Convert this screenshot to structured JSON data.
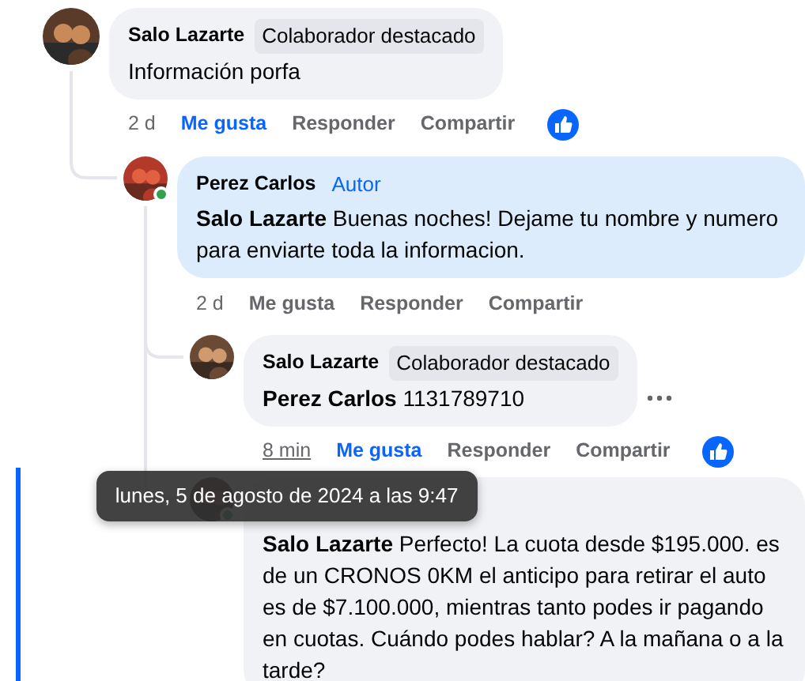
{
  "comments": [
    {
      "author": "Salo Lazarte",
      "badge": {
        "kind": "contributor",
        "label": "Colaborador destacado"
      },
      "text": "Información porfa",
      "tinted": false,
      "online": false,
      "time": "2 d",
      "time_hovered": false,
      "actions": [
        "Me gusta",
        "Responder",
        "Compartir"
      ],
      "liked": true,
      "reaction_shown": true,
      "children": [
        {
          "author": "Perez Carlos",
          "badge": {
            "kind": "author",
            "label": "Autor"
          },
          "text": "**Salo Lazarte** Buenas noches! Dejame tu nombre y numero para enviarte toda la informacion.",
          "tinted": true,
          "online": true,
          "time": "2 d",
          "time_hovered": false,
          "actions": [
            "Me gusta",
            "Responder",
            "Compartir"
          ],
          "liked": false,
          "children": [
            {
              "author": "Salo Lazarte",
              "badge": {
                "kind": "contributor",
                "label": "Colaborador destacado"
              },
              "text": "**Perez Carlos** 1131789710",
              "tinted": false,
              "online": false,
              "time": "8 min",
              "time_hovered": true,
              "tooltip": "lunes, 5 de agosto de 2024 a las 9:47",
              "actions": [
                "Me gusta",
                "Responder",
                "Compartir"
              ],
              "liked": true,
              "reaction_shown": true,
              "more_button": true
            },
            {
              "text": "**Salo Lazarte** Perfecto! La cuota desde $195.000. es de un CRONOS 0KM el anticipo para retirar el auto es de $7.100.000, mientras tanto podes ir pagando en cuotas. Cuándo podes hablar? A la mañana o a la tarde?",
              "tinted": false,
              "online": true,
              "highlighted": true
            }
          ]
        }
      ]
    }
  ]
}
